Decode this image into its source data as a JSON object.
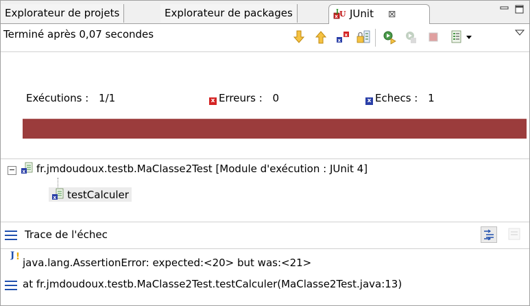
{
  "tabs": [
    {
      "label": "Explorateur de projets",
      "active": false
    },
    {
      "label": "Explorateur de packages",
      "active": false
    },
    {
      "label": "JUnit",
      "active": true,
      "close_glyph": "⊠"
    }
  ],
  "status": {
    "text": "Terminé après 0,07 secondes"
  },
  "toolbar_icons": [
    "next-failure-icon",
    "previous-failure-icon",
    "show-failures-only-icon",
    "scroll-lock-icon",
    "rerun-icon",
    "rerun-failed-first-icon",
    "stop-icon",
    "test-run-history-icon",
    "dropdown-arrow-icon",
    "view-menu-icon"
  ],
  "counters": {
    "runs_label": "Exécutions :",
    "runs_value": "1/1",
    "errors_label": "Erreurs :",
    "errors_value": "0",
    "failures_label": "Echecs :",
    "failures_value": "1",
    "error_color": "#d42424",
    "failure_color": "#2a3fa8"
  },
  "progress": {
    "color": "#9b3c3c",
    "fraction": 1.0
  },
  "tree": {
    "root": "fr.jmdoudoux.testb.MaClasse2Test [Module d'exécution : JUnit 4]",
    "child": "testCalculer",
    "toggle": "−"
  },
  "trace": {
    "title": "Trace de l'échec",
    "lines": [
      "java.lang.AssertionError: expected:<20> but was:<21>",
      "at fr.jmdoudoux.testb.MaClasse2Test.testCalculer(MaClasse2Test.java:13)"
    ]
  }
}
